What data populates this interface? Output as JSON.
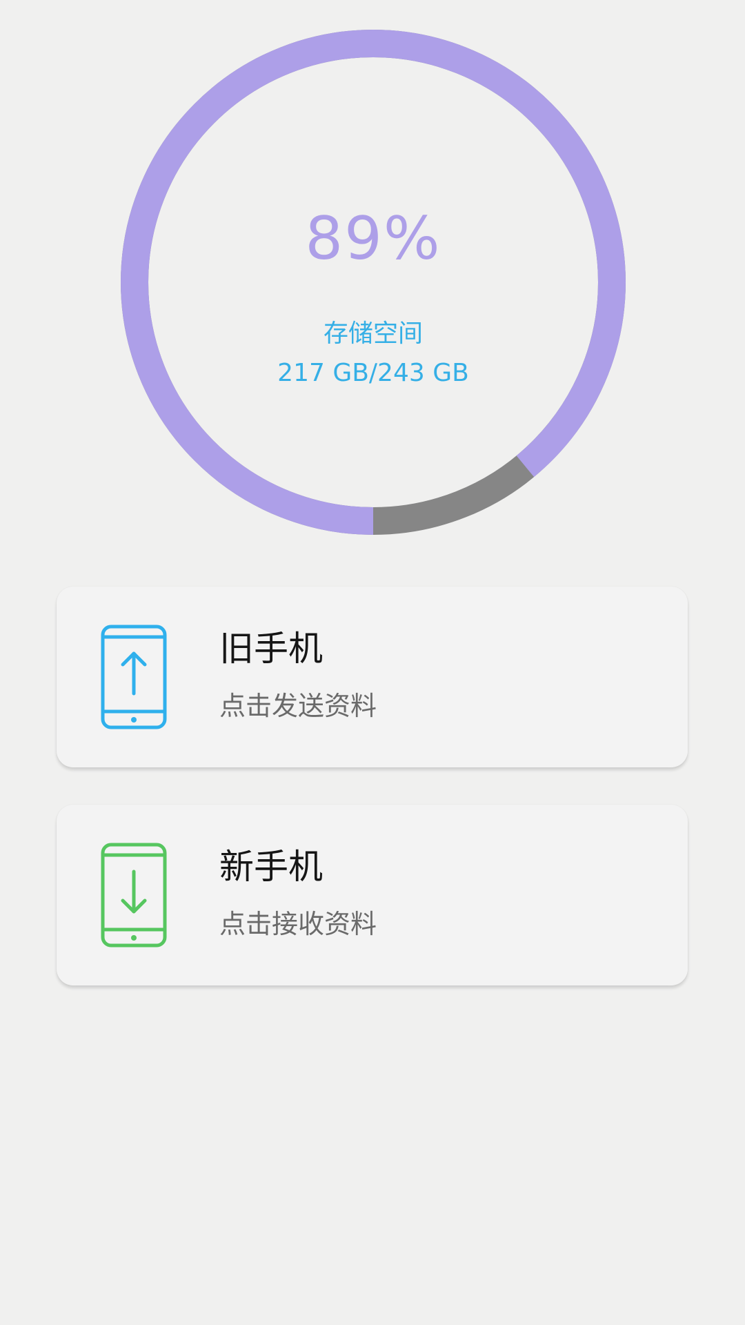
{
  "storage": {
    "percent_label": "89%",
    "used_fraction": 0.89,
    "label": "存储空间",
    "value": "217 GB/243 GB",
    "used_color": "#ad9fe8",
    "free_color": "#868686",
    "text_color": "#35afe6"
  },
  "cards": {
    "old_phone": {
      "title": "旧手机",
      "subtitle": "点击发送资料",
      "icon": "phone-upload-icon",
      "icon_color": "#2fb0ec"
    },
    "new_phone": {
      "title": "新手机",
      "subtitle": "点击接收资料",
      "icon": "phone-download-icon",
      "icon_color": "#56c65f"
    }
  }
}
